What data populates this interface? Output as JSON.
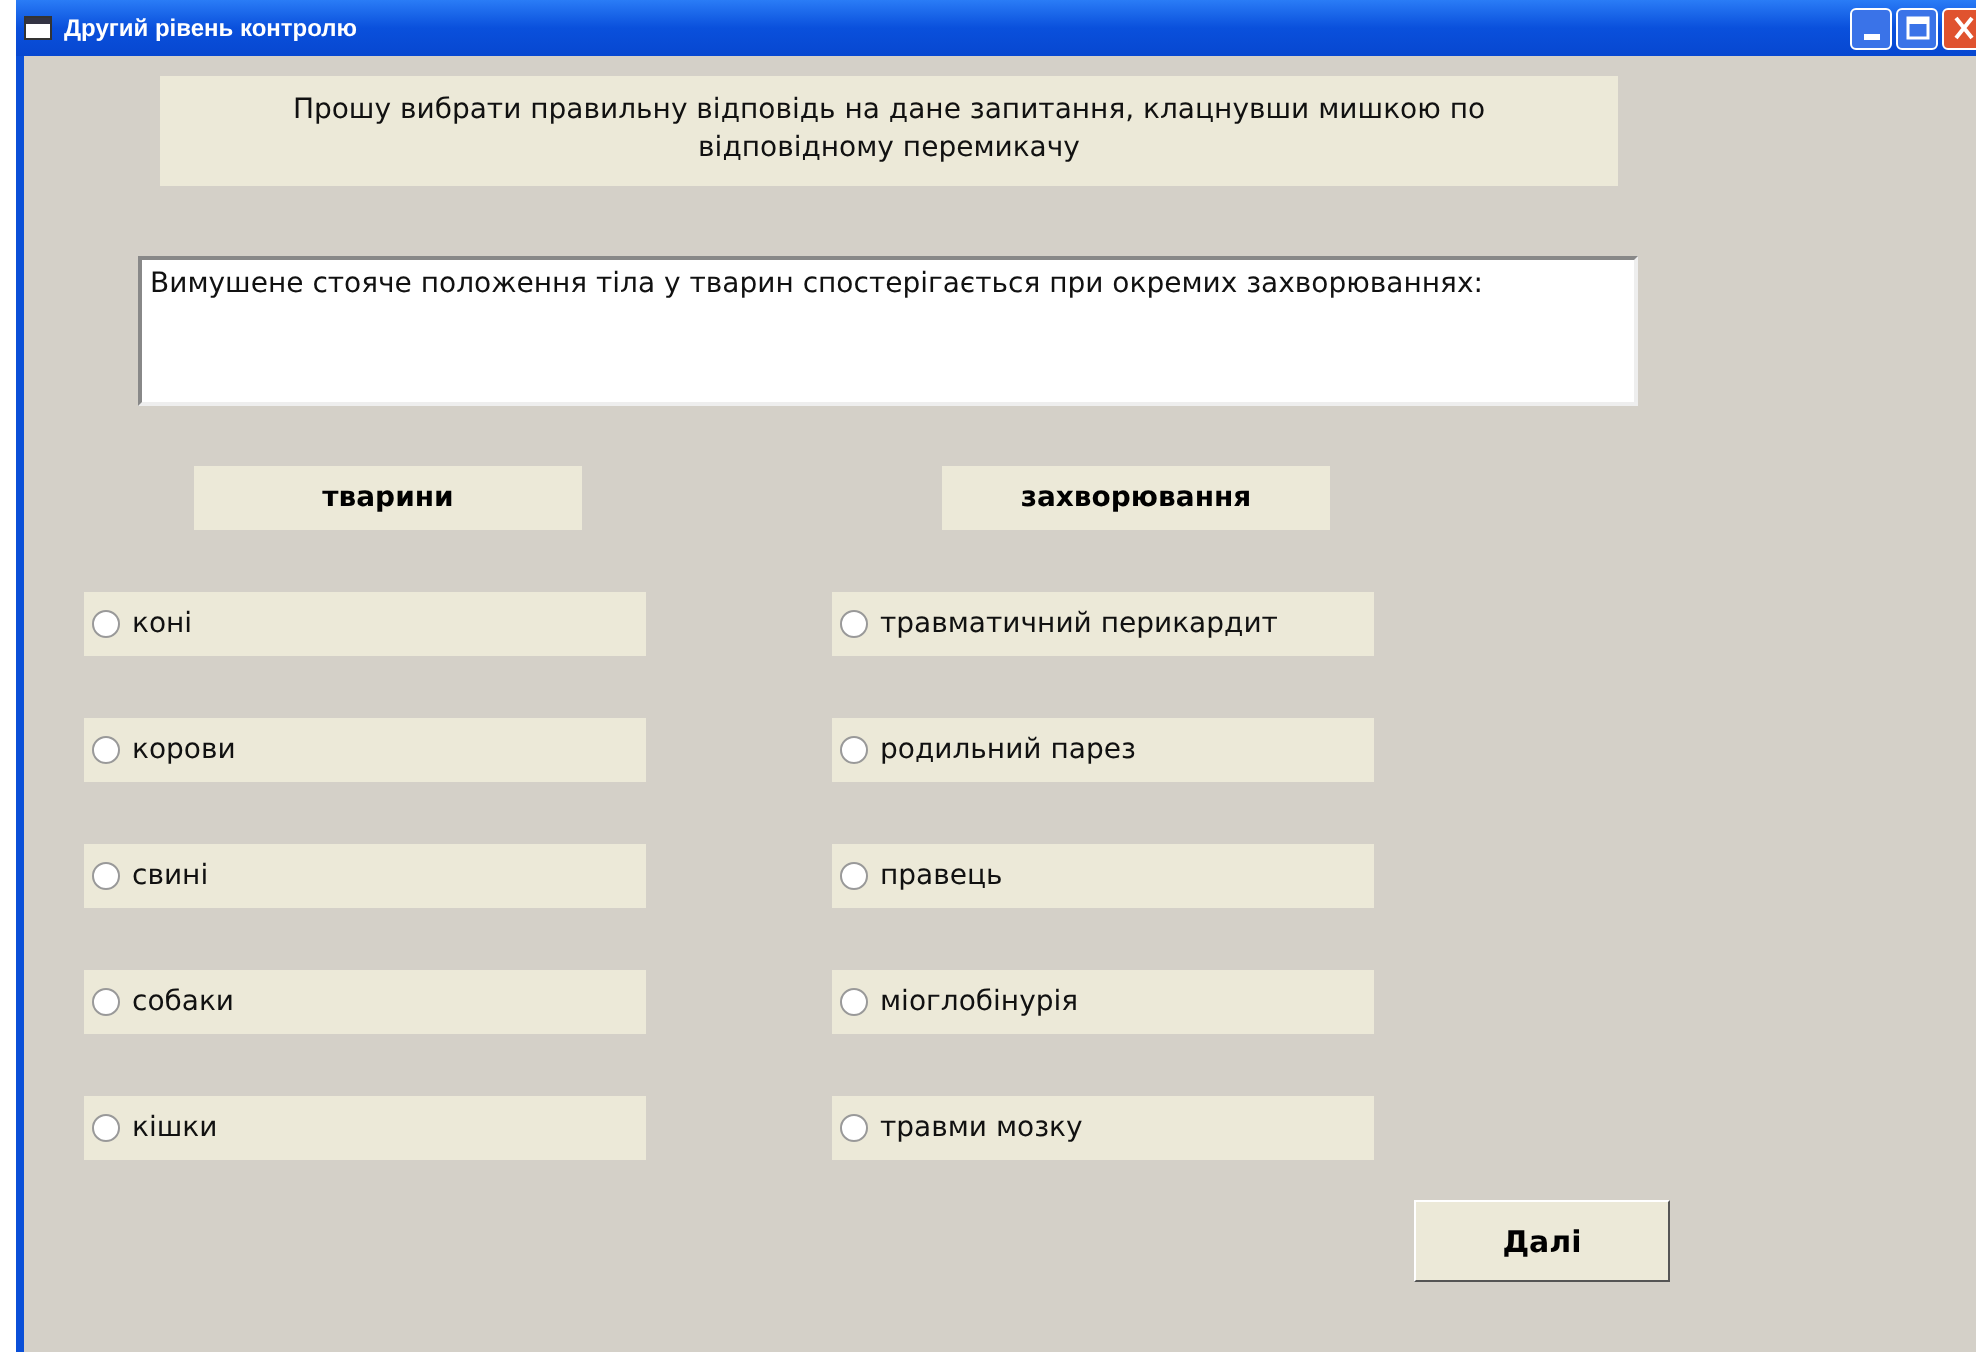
{
  "window": {
    "title": "Другий рівень контролю"
  },
  "instruction": "Прошу вибрати правильну відповідь на дане запитання, клацнувши мишкою по відповідному перемикачу",
  "question": "Вимушене стояче положення тіла у тварин спостерігається при окремих захворюваннях:",
  "columns": [
    {
      "heading": "тварини",
      "options": [
        {
          "label": "коні",
          "selected": false
        },
        {
          "label": "корови",
          "selected": false
        },
        {
          "label": "свині",
          "selected": false
        },
        {
          "label": "собаки",
          "selected": false
        },
        {
          "label": "кішки",
          "selected": false
        }
      ]
    },
    {
      "heading": "захворювання",
      "options": [
        {
          "label": "травматичний перикардит",
          "selected": false
        },
        {
          "label": "родильний парез",
          "selected": false
        },
        {
          "label": "правець",
          "selected": false
        },
        {
          "label": "міоглобінурія",
          "selected": false
        },
        {
          "label": "травми мозку",
          "selected": false
        }
      ]
    }
  ],
  "buttons": [
    "Далі"
  ]
}
